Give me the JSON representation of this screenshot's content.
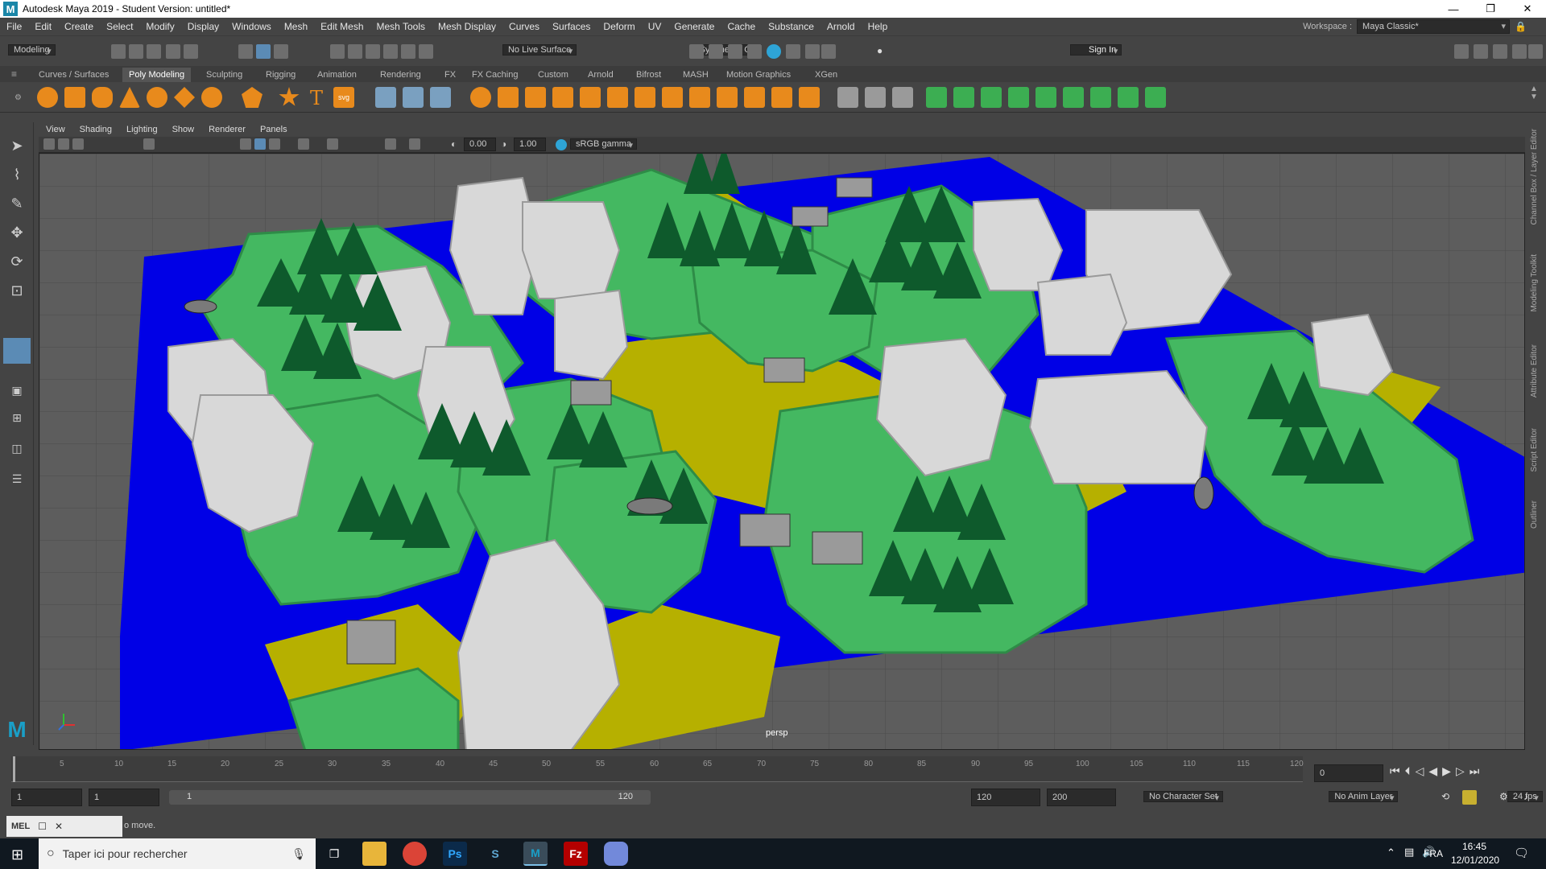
{
  "window": {
    "title": "Autodesk Maya 2019 - Student Version: untitled*",
    "logo": "M",
    "minimize": "—",
    "maximize": "❐",
    "close": "✕"
  },
  "menu": {
    "items": [
      "File",
      "Edit",
      "Create",
      "Select",
      "Modify",
      "Display",
      "Windows",
      "Mesh",
      "Edit Mesh",
      "Mesh Tools",
      "Mesh Display",
      "Curves",
      "Surfaces",
      "Deform",
      "UV",
      "Generate",
      "Cache",
      "Substance",
      "Arnold",
      "Help"
    ],
    "workspace_label": "Workspace :",
    "workspace_value": "Maya Classic*"
  },
  "status": {
    "mode": "Modeling",
    "live_surface": "No Live Surface",
    "symmetry": "Symmetry: Off",
    "sign_in": "Sign In"
  },
  "shelf": {
    "tabs": [
      "Curves / Surfaces",
      "Poly Modeling",
      "Sculpting",
      "Rigging",
      "Animation",
      "Rendering",
      "FX",
      "FX Caching",
      "Custom",
      "Arnold",
      "Bifrost",
      "MASH",
      "Motion Graphics",
      "XGen"
    ],
    "active_tab": "Poly Modeling"
  },
  "panel": {
    "menus": [
      "View",
      "Shading",
      "Lighting",
      "Show",
      "Renderer",
      "Panels"
    ],
    "near_value": "0.00",
    "far_value": "1.00",
    "color_space": "sRGB gamma",
    "camera_label": "persp"
  },
  "right_tabs": [
    "Channel Box / Layer Editor",
    "Modeling Toolkit",
    "Attribute Editor",
    "Script Editor",
    "Outliner"
  ],
  "timeline": {
    "ticks": [
      "5",
      "10",
      "15",
      "20",
      "25",
      "30",
      "35",
      "40",
      "45",
      "50",
      "55",
      "60",
      "65",
      "70",
      "75",
      "80",
      "85",
      "90",
      "95",
      "100",
      "105",
      "110",
      "115",
      "120"
    ],
    "current_frame": "0"
  },
  "range": {
    "start": "1",
    "start2": "1",
    "slider_start": "1",
    "slider_end": "120",
    "end": "120",
    "end2": "200",
    "character_set": "No Character Set",
    "anim_layer": "No Anim Layer",
    "fps": "24 fps"
  },
  "command": {
    "mel": "MEL",
    "help_text": "o move."
  },
  "taskbar": {
    "search_placeholder": "Taper ici pour rechercher",
    "language": "FRA",
    "time": "16:45",
    "date": "12/01/2020"
  },
  "colors": {
    "water": "#0000e6",
    "grass": "#44b861",
    "grass_dark": "#2e8c47",
    "sand": "#b6b000",
    "rock": "#d8d8d8",
    "tree": "#0e5a2c",
    "ground": "#5d5d5d"
  }
}
